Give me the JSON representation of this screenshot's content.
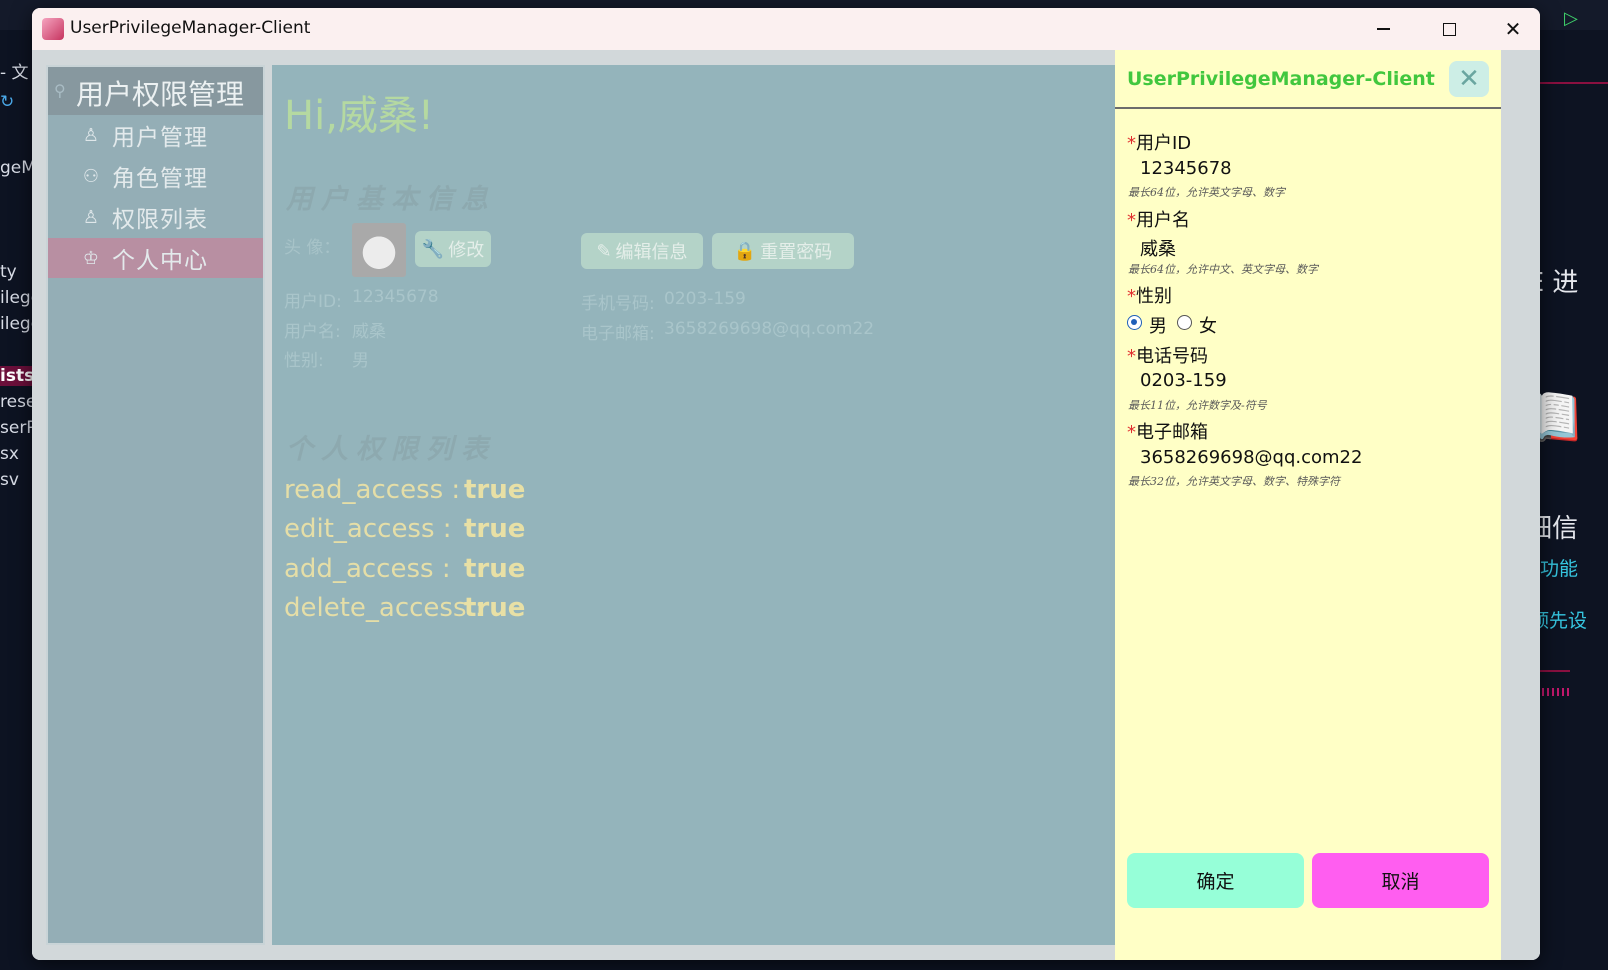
{
  "window": {
    "title": "UserPrivilegeManager-Client"
  },
  "background_ide": {
    "left_fragments": [
      "- 文",
      "geMa",
      "ty",
      "ilege",
      "ilege",
      "ists.",
      "reset",
      "serP",
      "sx",
      "sv"
    ],
    "right_fragments": {
      "ide": "IDE 进",
      "detail": "详细信",
      "learn": "解新功能",
      "preview": "ke 预先设"
    }
  },
  "sidebar": {
    "title": "用户权限管理",
    "items": [
      {
        "label": "用户管理",
        "icon": "user-icon"
      },
      {
        "label": "角色管理",
        "icon": "users-icon"
      },
      {
        "label": "权限列表",
        "icon": "user-key-icon"
      },
      {
        "label": "个人中心",
        "icon": "crown-icon",
        "active": true
      }
    ]
  },
  "main": {
    "greeting": "Hi,威桑!",
    "basic_info_title": "用户基本信息",
    "avatar_label": "头 像：",
    "modify_label": "修改",
    "edit_info_label": "编辑信息",
    "reset_pwd_label": "重置密码",
    "fields": {
      "user_id_label": "用户ID:",
      "user_id": "12345678",
      "username_label": "用户名:",
      "username": "威桑",
      "gender_label": "性别:",
      "gender": "男",
      "phone_label": "手机号码:",
      "phone": "0203-159",
      "email_label": "电子邮箱:",
      "email": "3658269698@qq.com22"
    },
    "perm_title": "个人权限列表",
    "permissions": [
      {
        "key": "read_access :",
        "value": "true"
      },
      {
        "key": "edit_access :",
        "value": "true"
      },
      {
        "key": "add_access :",
        "value": "true"
      },
      {
        "key": "delete_access :",
        "value": "true"
      }
    ]
  },
  "drawer": {
    "title": "UserPrivilegeManager-Client",
    "required_mark": "*",
    "user_id": {
      "label": "用户ID",
      "value": "12345678",
      "hint": "最长64位，允许英文字母、数字"
    },
    "username": {
      "label": "用户名",
      "value": "威桑",
      "hint": "最长64位，允许中文、英文字母、数字"
    },
    "gender": {
      "label": "性别",
      "options": [
        "男",
        "女"
      ],
      "selected": "男"
    },
    "phone": {
      "label": "电话号码",
      "value": "0203-159",
      "hint": "最长11位，允许数字及-符号"
    },
    "email": {
      "label": "电子邮箱",
      "value": "3658269698@qq.com22",
      "hint": "最长32位，允许英文字母、数字、特殊字符"
    },
    "ok_label": "确定",
    "cancel_label": "取消"
  },
  "colors": {
    "drawer_bg": "#ffffc6",
    "drawer_title": "#41c73e",
    "ok_button": "#96ffd8",
    "cancel_button": "#ff5ef0",
    "sidebar_active": "#b88fa2",
    "greeting": "#b5d9a1"
  }
}
